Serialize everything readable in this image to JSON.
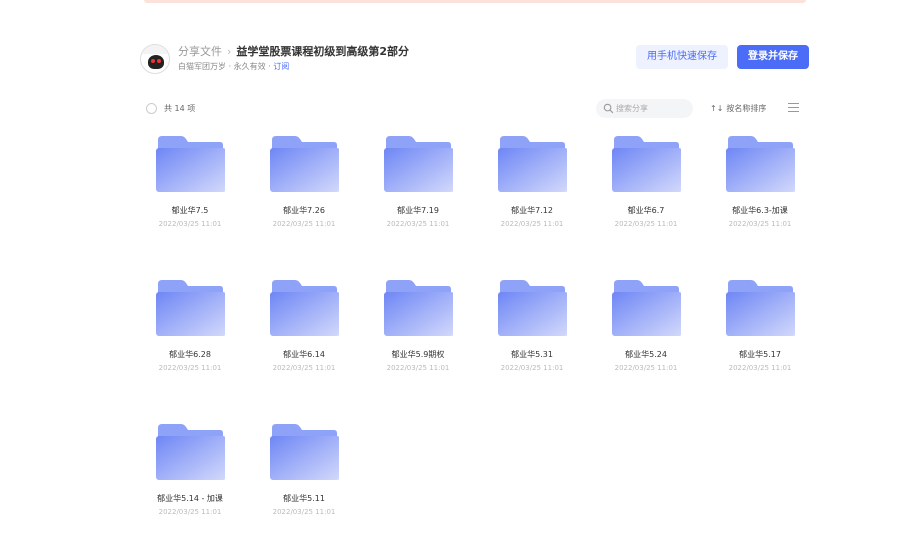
{
  "header": {
    "breadcrumb_root": "分享文件",
    "breadcrumb_sep": "›",
    "title": "益学堂股票课程初级到高级第2部分",
    "sharer": "白猫军团万岁",
    "validity": "· 永久有效 ·",
    "subscribe": "订阅",
    "quick_save_label": "用手机快速保存",
    "save_label": "登录并保存"
  },
  "toolbar": {
    "count": "共 14 项",
    "search_placeholder": "搜索分享",
    "sort_label": "按名称排序",
    "sort_arrows": "↑↓"
  },
  "files": [
    {
      "name": "郁业华7.5",
      "date": "2022/03/25 11:01"
    },
    {
      "name": "郁业华7.26",
      "date": "2022/03/25 11:01"
    },
    {
      "name": "郁业华7.19",
      "date": "2022/03/25 11:01"
    },
    {
      "name": "郁业华7.12",
      "date": "2022/03/25 11:01"
    },
    {
      "name": "郁业华6.7",
      "date": "2022/03/25 11:01"
    },
    {
      "name": "郁业华6.3-加课",
      "date": "2022/03/25 11:01"
    },
    {
      "name": "郁业华6.28",
      "date": "2022/03/25 11:01"
    },
    {
      "name": "郁业华6.14",
      "date": "2022/03/25 11:01"
    },
    {
      "name": "郁业华5.9期权",
      "date": "2022/03/25 11:01"
    },
    {
      "name": "郁业华5.31",
      "date": "2022/03/25 11:01"
    },
    {
      "name": "郁业华5.24",
      "date": "2022/03/25 11:01"
    },
    {
      "name": "郁业华5.17",
      "date": "2022/03/25 11:01"
    },
    {
      "name": "郁业华5.14 - 加课",
      "date": "2022/03/25 11:01"
    },
    {
      "name": "郁业华5.11",
      "date": "2022/03/25 11:01"
    }
  ],
  "icons": {
    "folder": "folder-icon",
    "search": "search-icon",
    "list": "list-view-icon",
    "avatar": "avatar"
  },
  "colors": {
    "accent": "#4a6cf7",
    "folder_front_start": "#6e86f5",
    "folder_front_end": "#d3d9fb",
    "folder_back": "#8ea2f7"
  }
}
